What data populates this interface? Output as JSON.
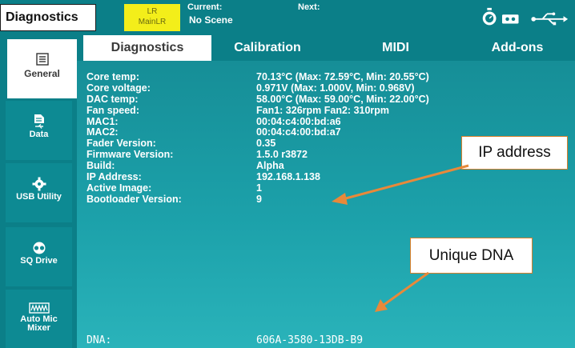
{
  "topbar": {
    "title": "Diagnostics",
    "lr_line1": "LR",
    "lr_line2": "MainLR",
    "current_label": "Current:",
    "current_value": "No Scene",
    "next_label": "Next:",
    "icons": [
      "stopwatch-icon",
      "tape-icon",
      "usb-icon"
    ]
  },
  "sidebar": {
    "items": [
      {
        "label": "General",
        "icon": "list-icon",
        "active": true
      },
      {
        "label": "Data",
        "icon": "file-usb-icon"
      },
      {
        "label": "USB Utility",
        "icon": "gear-icon"
      },
      {
        "label": "SQ Drive",
        "icon": "tape-reel-icon"
      },
      {
        "label": "Auto Mic Mixer",
        "icon": "automixer-icon"
      }
    ]
  },
  "tabs": [
    {
      "label": "Diagnostics",
      "active": true
    },
    {
      "label": "Calibration"
    },
    {
      "label": "MIDI"
    },
    {
      "label": "Add-ons"
    }
  ],
  "diagnostics": [
    {
      "key": "Core temp:",
      "value": "70.13°C (Max: 72.59°C, Min: 20.55°C)"
    },
    {
      "key": "Core voltage:",
      "value": "0.971V  (Max: 1.000V,  Min: 0.968V)"
    },
    {
      "key": "DAC temp:",
      "value": "58.00°C  (Max: 59.00°C, Min: 22.00°C)"
    },
    {
      "key": "Fan speed:",
      "value": "Fan1: 326rpm  Fan2: 310rpm"
    },
    {
      "key": "MAC1:",
      "value": "00:04:c4:00:bd:a6"
    },
    {
      "key": "MAC2:",
      "value": "00:04:c4:00:bd:a7"
    },
    {
      "key": "Fader Version:",
      "value": "0.35"
    },
    {
      "key": "Firmware Version:",
      "value": "1.5.0 r3872"
    },
    {
      "key": "Build:",
      "value": "Alpha"
    },
    {
      "key": "IP Address:",
      "value": "192.168.1.138"
    },
    {
      "key": "Active Image:",
      "value": "1"
    },
    {
      "key": "Bootloader Version:",
      "value": "9"
    }
  ],
  "dna": {
    "label": "DNA:",
    "value": "606A-3580-13DB-B9"
  },
  "callouts": {
    "ip": "IP address",
    "dna": "Unique DNA"
  },
  "colors": {
    "teal": "#0b7f88",
    "accent_yellow": "#f3ee1a",
    "callout_border": "#d97f2a",
    "arrow": "#e8893a"
  }
}
